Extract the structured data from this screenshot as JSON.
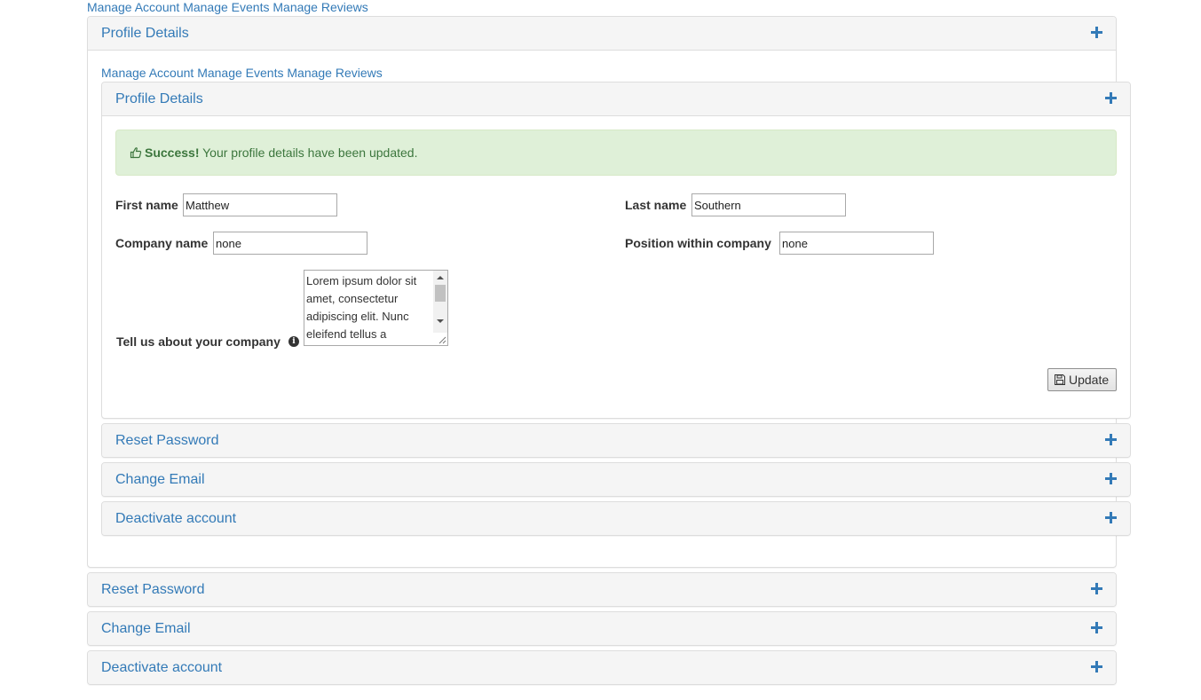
{
  "outer": {
    "nav": {
      "manage_account": "Manage Account",
      "manage_events": "Manage Events",
      "manage_reviews": "Manage Reviews"
    },
    "profile_title": "Profile Details",
    "sections": {
      "reset_password": "Reset Password",
      "change_email": "Change Email",
      "deactivate_account": "Deactivate account"
    }
  },
  "inner": {
    "nav": {
      "manage_account": "Manage Account",
      "manage_events": "Manage Events",
      "manage_reviews": "Manage Reviews"
    },
    "profile_title": "Profile Details",
    "alert": {
      "strong": "Success!",
      "message": "Your profile details have been updated.",
      "icon": "thumbs-up-icon"
    },
    "form": {
      "first_name_label": "First name",
      "first_name_value": "Matthew",
      "last_name_label": "Last name",
      "last_name_value": "Southern",
      "company_name_label": "Company name",
      "company_name_value": "none",
      "position_label": "Position within company",
      "position_value": "none",
      "about_label": "Tell us about your company",
      "about_value": "Lorem ipsum dolor sit amet, consectetur adipiscing elit. Nunc eleifend tellus a",
      "update_label": "Update"
    },
    "sections": {
      "reset_password": "Reset Password",
      "change_email": "Change Email",
      "deactivate_account": "Deactivate account"
    }
  },
  "colors": {
    "link": "#337ab7",
    "panel_heading_bg": "#f5f5f5",
    "panel_border": "#dddddd",
    "success_bg": "#dff0d8",
    "success_text": "#3c763d"
  }
}
